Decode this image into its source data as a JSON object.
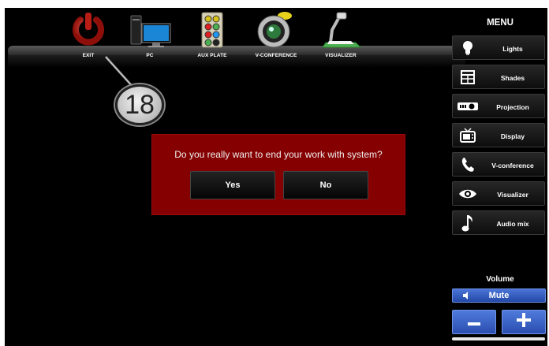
{
  "sources": [
    {
      "id": "exit",
      "label": "EXIT",
      "icon": "power-icon"
    },
    {
      "id": "pc",
      "label": "PC",
      "icon": "pc-icon"
    },
    {
      "id": "aux",
      "label": "AUX PLATE",
      "icon": "aux-plate-icon"
    },
    {
      "id": "vconf",
      "label": "V-CONFERENCE",
      "icon": "camera-icon"
    },
    {
      "id": "visualizer",
      "label": "VISUALIZER",
      "icon": "document-camera-icon"
    }
  ],
  "callout": {
    "number": "18"
  },
  "dialog": {
    "message": "Do you really want to end your work with system?",
    "yes_label": "Yes",
    "no_label": "No"
  },
  "menu": {
    "title": "MENU",
    "items": [
      {
        "label": "Lights",
        "icon": "bulb-icon"
      },
      {
        "label": "Shades",
        "icon": "window-icon"
      },
      {
        "label": "Projection",
        "icon": "projector-icon"
      },
      {
        "label": "Display",
        "icon": "tv-icon"
      },
      {
        "label": "V-conference",
        "icon": "phone-icon"
      },
      {
        "label": "Visualizer",
        "icon": "eye-icon"
      },
      {
        "label": "Audio mix",
        "icon": "music-note-icon"
      }
    ]
  },
  "volume": {
    "title": "Volume",
    "mute_label": "Mute",
    "minus_icon": "minus-icon",
    "plus_icon": "plus-icon"
  },
  "colors": {
    "dialog_bg": "#850001",
    "volume_blue": "#3a62c4",
    "exit_red": "#c0271f",
    "background": "#000000"
  }
}
